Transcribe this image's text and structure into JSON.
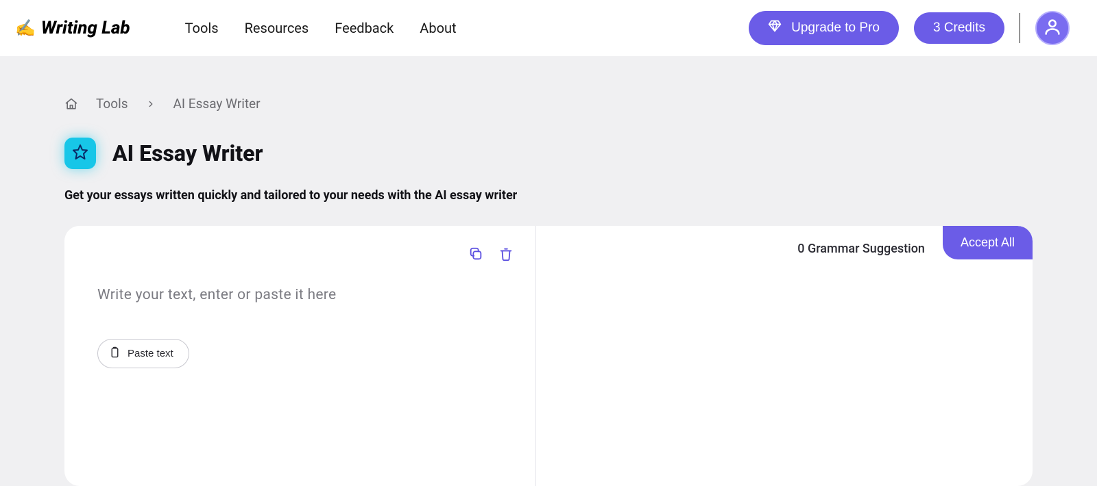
{
  "header": {
    "logo_text": "Writing Lab",
    "nav": [
      "Tools",
      "Resources",
      "Feedback",
      "About"
    ],
    "upgrade_label": "Upgrade to Pro",
    "credits_label": "3 Credits"
  },
  "breadcrumb": {
    "items": [
      "Tools",
      "AI Essay Writer"
    ]
  },
  "page": {
    "title": "AI Essay Writer",
    "subtitle": "Get your essays written quickly and tailored to your needs with the AI essay writer"
  },
  "editor": {
    "placeholder": "Write your text, enter or paste it here",
    "paste_label": "Paste text",
    "suggestion_text": "0 Grammar Suggestion",
    "accept_all_label": "Accept All"
  },
  "colors": {
    "accent": "#6b5ce7",
    "badge": "#17c6e8"
  }
}
